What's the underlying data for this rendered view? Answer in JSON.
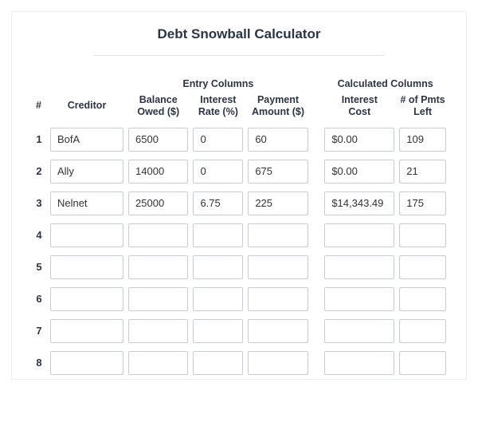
{
  "title": "Debt Snowball Calculator",
  "headers": {
    "group_entry": "Entry Columns",
    "group_calc": "Calculated Columns",
    "num": "#",
    "creditor": "Creditor",
    "balance1": "Balance",
    "balance2": "Owed ($)",
    "rate1": "Interest",
    "rate2": "Rate (%)",
    "payment1": "Payment",
    "payment2": "Amount ($)",
    "intcost1": "Interest",
    "intcost2": "Cost",
    "pmts1": "# of Pmts",
    "pmts2": "Left"
  },
  "rows": [
    {
      "n": "1",
      "creditor": "BofA",
      "balance": "6500",
      "rate": "0",
      "payment": "60",
      "interest": "$0.00",
      "pmts": "109",
      "spellerr": false
    },
    {
      "n": "2",
      "creditor": "Ally",
      "balance": "14000",
      "rate": "0",
      "payment": "675",
      "interest": "$0.00",
      "pmts": "21",
      "spellerr": false
    },
    {
      "n": "3",
      "creditor": "Nelnet",
      "balance": "25000",
      "rate": "6.75",
      "payment": "225",
      "interest": "$14,343.49",
      "pmts": "175",
      "spellerr": true
    },
    {
      "n": "4",
      "creditor": "",
      "balance": "",
      "rate": "",
      "payment": "",
      "interest": "",
      "pmts": "",
      "spellerr": false
    },
    {
      "n": "5",
      "creditor": "",
      "balance": "",
      "rate": "",
      "payment": "",
      "interest": "",
      "pmts": "",
      "spellerr": false
    },
    {
      "n": "6",
      "creditor": "",
      "balance": "",
      "rate": "",
      "payment": "",
      "interest": "",
      "pmts": "",
      "spellerr": false
    },
    {
      "n": "7",
      "creditor": "",
      "balance": "",
      "rate": "",
      "payment": "",
      "interest": "",
      "pmts": "",
      "spellerr": false
    },
    {
      "n": "8",
      "creditor": "",
      "balance": "",
      "rate": "",
      "payment": "",
      "interest": "",
      "pmts": "",
      "spellerr": false
    }
  ]
}
